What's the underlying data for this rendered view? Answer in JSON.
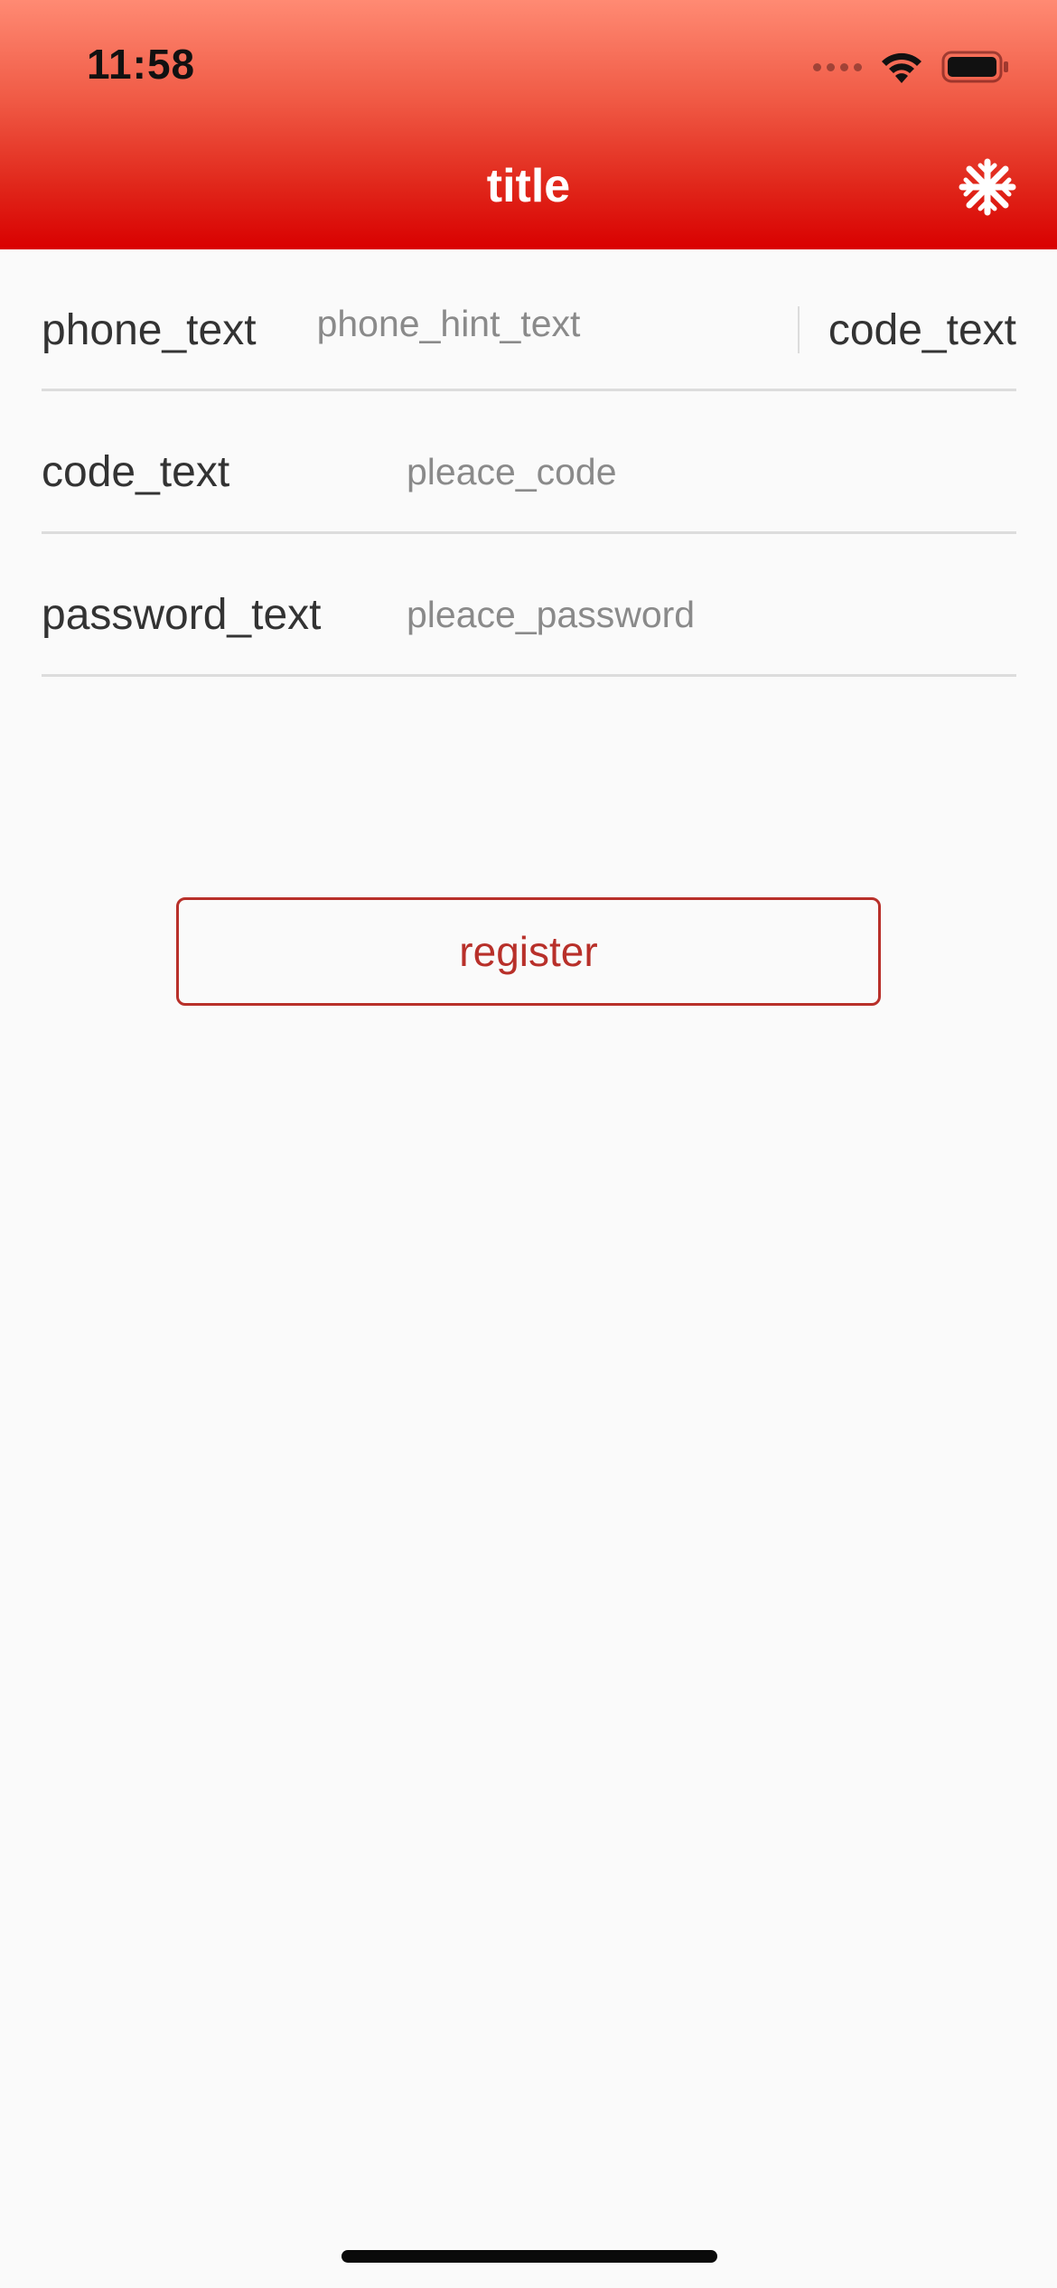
{
  "status_bar": {
    "time": "11:58",
    "icons": [
      "signal-dots-icon",
      "wifi-icon",
      "battery-icon"
    ]
  },
  "header": {
    "title": "title",
    "action_icon": "snowflake-icon",
    "gradient_top": "#ff8a73",
    "gradient_bottom": "#d90000"
  },
  "form": {
    "phone": {
      "label": "phone_text",
      "placeholder": "phone_hint_text",
      "code_button": "code_text"
    },
    "code": {
      "label": "code_text",
      "placeholder": "pleace_code"
    },
    "password": {
      "label": "password_text",
      "placeholder": "pleace_password"
    }
  },
  "register": {
    "label": "register",
    "color": "#b8302a"
  }
}
